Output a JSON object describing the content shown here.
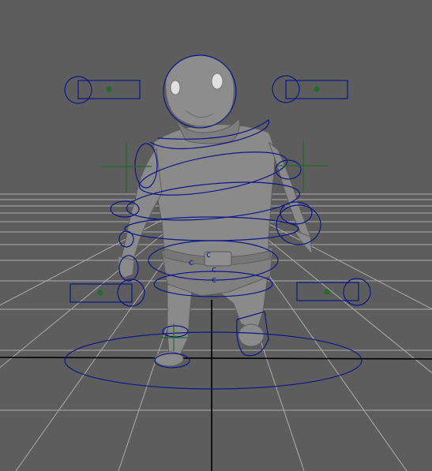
{
  "viewport": {
    "panel": "persp",
    "background_color": "#5d5d5d",
    "grid_color": "#b9b9b9",
    "axis_color": "#000000",
    "green_axis_color": "#1f6e2a",
    "control_curve_color": "#0c1788",
    "character_color": "#8a8a8a"
  },
  "controls": {
    "spine_ik_labels": [
      "c",
      "c",
      "c",
      "c"
    ]
  },
  "icons": {
    "head_ctrl": "head-control-circle-icon",
    "shoulder_ctrl": "shoulder-box-icon",
    "hip_ctrl": "hip-box-icon",
    "locator": "locator-cross-icon"
  }
}
